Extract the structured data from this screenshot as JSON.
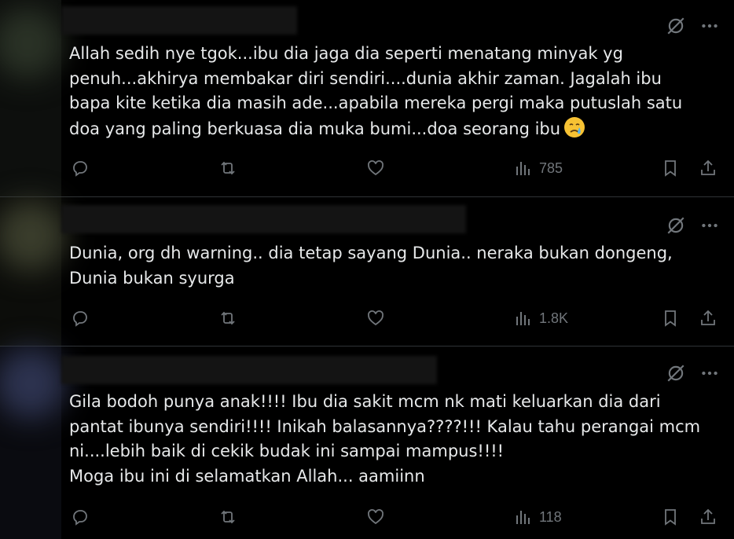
{
  "posts": [
    {
      "body": "Allah sedih nye tgok...ibu dia jaga dia seperti menatang minyak yg\npenuh...akhirya membakar diri sendiri....dunia akhir zaman. Jagalah ibu\nbapa kite ketika dia masih ade...apabila mereka pergi maka putuslah satu\ndoa yang paling berkuasa dia muka bumi...doa seorang ibu",
      "emoji": "crying-face",
      "views": "785"
    },
    {
      "body": "Dunia, org dh warning.. dia tetap sayang Dunia.. neraka bukan dongeng,\nDunia bukan syurga",
      "views": "1.8K"
    },
    {
      "body": "Gila bodoh punya anak!!!! Ibu dia sakit mcm nk mati keluarkan dia dari\npantat ibunya sendiri!!!! Inikah balasannya????!!! Kalau tahu perangai mcm\nni....lebih baik di cekik budak ini sampai mampus!!!!\nMoga ibu ini di selamatkan Allah... aamiinn",
      "views": "118"
    }
  ],
  "colors": {
    "background": "#000000",
    "text": "#e7e9ea",
    "muted": "#71767b",
    "divider": "#2f3336"
  },
  "icons": [
    "grok-icon",
    "more-icon",
    "reply-icon",
    "repost-icon",
    "like-icon",
    "views-icon",
    "bookmark-icon",
    "share-icon"
  ]
}
